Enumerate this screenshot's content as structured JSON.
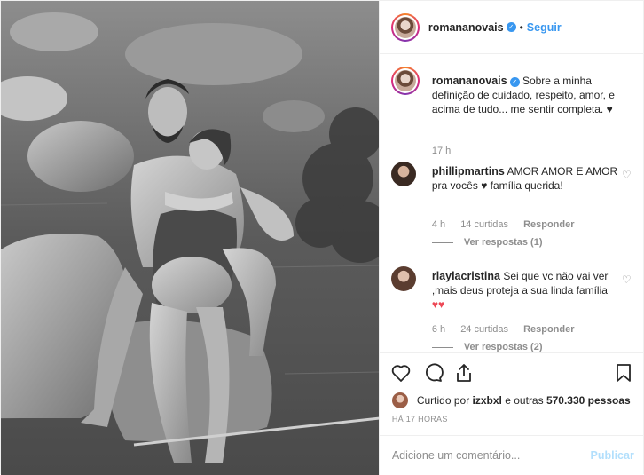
{
  "post": {
    "author": "romananovais",
    "follow_label": "Seguir",
    "dot": "•",
    "verified_mark": "✓"
  },
  "comments": [
    {
      "username": "romananovais",
      "text": "Sobre a minha definição de cuidado, respeito, amor, e acima de tudo... me sentir completa. ♥",
      "time": "17 h"
    },
    {
      "username": "phillipmartins",
      "text": "AMOR AMOR E AMOR pra vocês ♥ família querida!",
      "time": "4 h",
      "likes": "14 curtidas",
      "reply": "Responder",
      "view_replies": "Ver respostas (1)"
    },
    {
      "username": "rlaylacristina",
      "text": "Sei que vc não vai ver ,mais deus proteja a sua linda família",
      "hearts": "♥♥",
      "time": "6 h",
      "likes": "24 curtidas",
      "reply": "Responder",
      "view_replies": "Ver respostas (2)"
    }
  ],
  "liked_by": {
    "prefix": "Curtido por",
    "user": "izxbxl",
    "connector": "e outras",
    "count": "570.330 pessoas"
  },
  "timestamp": "HÁ 17 HORAS",
  "add_comment": {
    "placeholder": "Adicione um comentário...",
    "publish_label": "Publicar"
  },
  "icons": {
    "like": "heart-icon",
    "comment": "comment-bubble-icon",
    "share": "share-icon",
    "save": "bookmark-icon"
  },
  "colors": {
    "link_blue": "#3897f0",
    "publish_disabled": "#b2dffc",
    "muted": "#8e8e8e",
    "heart_red": "#ed4956"
  }
}
